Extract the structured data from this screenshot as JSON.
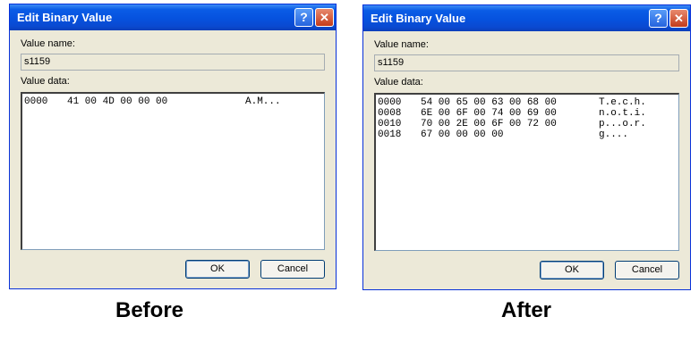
{
  "before": {
    "title": "Edit Binary Value",
    "help_glyph": "?",
    "close_glyph": "✕",
    "value_name_label": "Value name:",
    "value_name": "s1159",
    "value_data_label": "Value data:",
    "rows": [
      {
        "addr": "0000",
        "bytes": "41 00 4D 00 00 00",
        "ascii": "A.M..."
      }
    ],
    "ok_label": "OK",
    "cancel_label": "Cancel",
    "caption": "Before"
  },
  "after": {
    "title": "Edit Binary Value",
    "help_glyph": "?",
    "close_glyph": "✕",
    "value_name_label": "Value name:",
    "value_name": "s1159",
    "value_data_label": "Value data:",
    "rows": [
      {
        "addr": "0000",
        "bytes": "54 00 65 00 63 00 68 00",
        "ascii": "T.e.c.h."
      },
      {
        "addr": "0008",
        "bytes": "6E 00 6F 00 74 00 69 00",
        "ascii": "n.o.t.i."
      },
      {
        "addr": "0010",
        "bytes": "70 00 2E 00 6F 00 72 00",
        "ascii": "p...o.r."
      },
      {
        "addr": "0018",
        "bytes": "67 00 00 00 00",
        "ascii": "g...."
      }
    ],
    "ok_label": "OK",
    "cancel_label": "Cancel",
    "caption": "After"
  }
}
